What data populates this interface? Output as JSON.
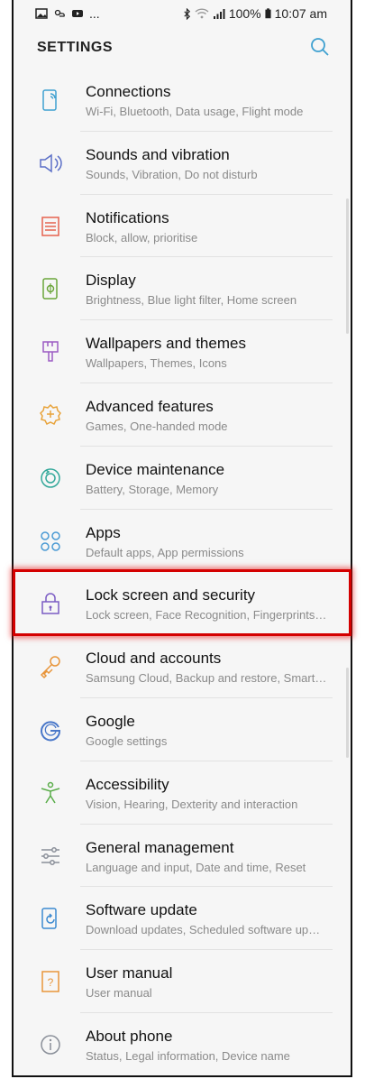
{
  "status_bar": {
    "left_more": "...",
    "battery": "100%",
    "time": "10:07 am"
  },
  "header": {
    "title": "SETTINGS"
  },
  "items": [
    {
      "key": "connections",
      "label": "Connections",
      "sub": "Wi-Fi, Bluetooth, Data usage, Flight mode",
      "icon": "connections-icon",
      "color": "#3ea0d0"
    },
    {
      "key": "sounds",
      "label": "Sounds and vibration",
      "sub": "Sounds, Vibration, Do not disturb",
      "icon": "speaker-icon",
      "color": "#5b6fc7"
    },
    {
      "key": "notifications",
      "label": "Notifications",
      "sub": "Block, allow, prioritise",
      "icon": "notifications-icon",
      "color": "#e5624f"
    },
    {
      "key": "display",
      "label": "Display",
      "sub": "Brightness, Blue light filter, Home screen",
      "icon": "display-icon",
      "color": "#6aa53a"
    },
    {
      "key": "wallpapers",
      "label": "Wallpapers and themes",
      "sub": "Wallpapers, Themes, Icons",
      "icon": "brush-icon",
      "color": "#9c5bc4"
    },
    {
      "key": "advanced",
      "label": "Advanced features",
      "sub": "Games, One-handed mode",
      "icon": "advanced-gear-icon",
      "color": "#e8a33a"
    },
    {
      "key": "maintenance",
      "label": "Device maintenance",
      "sub": "Battery, Storage, Memory",
      "icon": "maintenance-icon",
      "color": "#33a89a"
    },
    {
      "key": "apps",
      "label": "Apps",
      "sub": "Default apps, App permissions",
      "icon": "apps-icon",
      "color": "#4a9ad4"
    },
    {
      "key": "lock",
      "label": "Lock screen and security",
      "sub": "Lock screen, Face Recognition, Fingerprints…",
      "icon": "lock-icon",
      "color": "#7a5bc4"
    },
    {
      "key": "cloud",
      "label": "Cloud and accounts",
      "sub": "Samsung Cloud, Backup and restore, Smart…",
      "icon": "key-icon",
      "color": "#e8953a"
    },
    {
      "key": "google",
      "label": "Google",
      "sub": "Google settings",
      "icon": "google-icon",
      "color": "#4a78c9"
    },
    {
      "key": "accessibility",
      "label": "Accessibility",
      "sub": "Vision, Hearing, Dexterity and interaction",
      "icon": "accessibility-icon",
      "color": "#5aad4a"
    },
    {
      "key": "general",
      "label": "General management",
      "sub": "Language and input, Date and time, Reset",
      "icon": "sliders-icon",
      "color": "#8a8f99"
    },
    {
      "key": "software",
      "label": "Software update",
      "sub": "Download updates, Scheduled software up…",
      "icon": "software-update-icon",
      "color": "#3c8ad0"
    },
    {
      "key": "manual",
      "label": "User manual",
      "sub": "User manual",
      "icon": "manual-icon",
      "color": "#e8953a"
    },
    {
      "key": "about",
      "label": "About phone",
      "sub": "Status, Legal information, Device name",
      "icon": "info-icon",
      "color": "#8a8f99"
    }
  ],
  "highlighted_item": "lock"
}
